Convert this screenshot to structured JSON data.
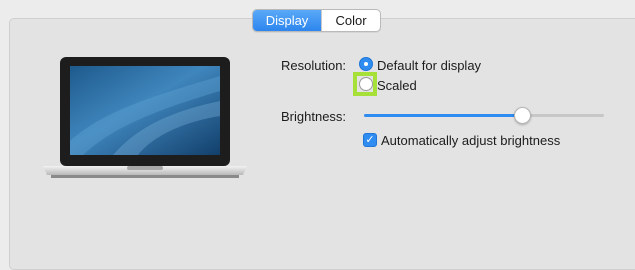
{
  "tabs": [
    {
      "label": "Display",
      "active": true
    },
    {
      "label": "Color",
      "active": false
    }
  ],
  "display": {
    "resolution_label": "Resolution:",
    "resolution_options": [
      {
        "label": "Default for display",
        "selected": true
      },
      {
        "label": "Scaled",
        "selected": false
      }
    ],
    "brightness_label": "Brightness:",
    "brightness_value": 0.66,
    "auto_brightness_label": "Automatically adjust brightness",
    "auto_brightness_checked": true
  },
  "icons": {
    "laptop": "laptop-icon",
    "checkmark": "checkmark-icon"
  },
  "colors": {
    "accent": "#2f8cf0",
    "focus_ring": "#a8e03a"
  }
}
